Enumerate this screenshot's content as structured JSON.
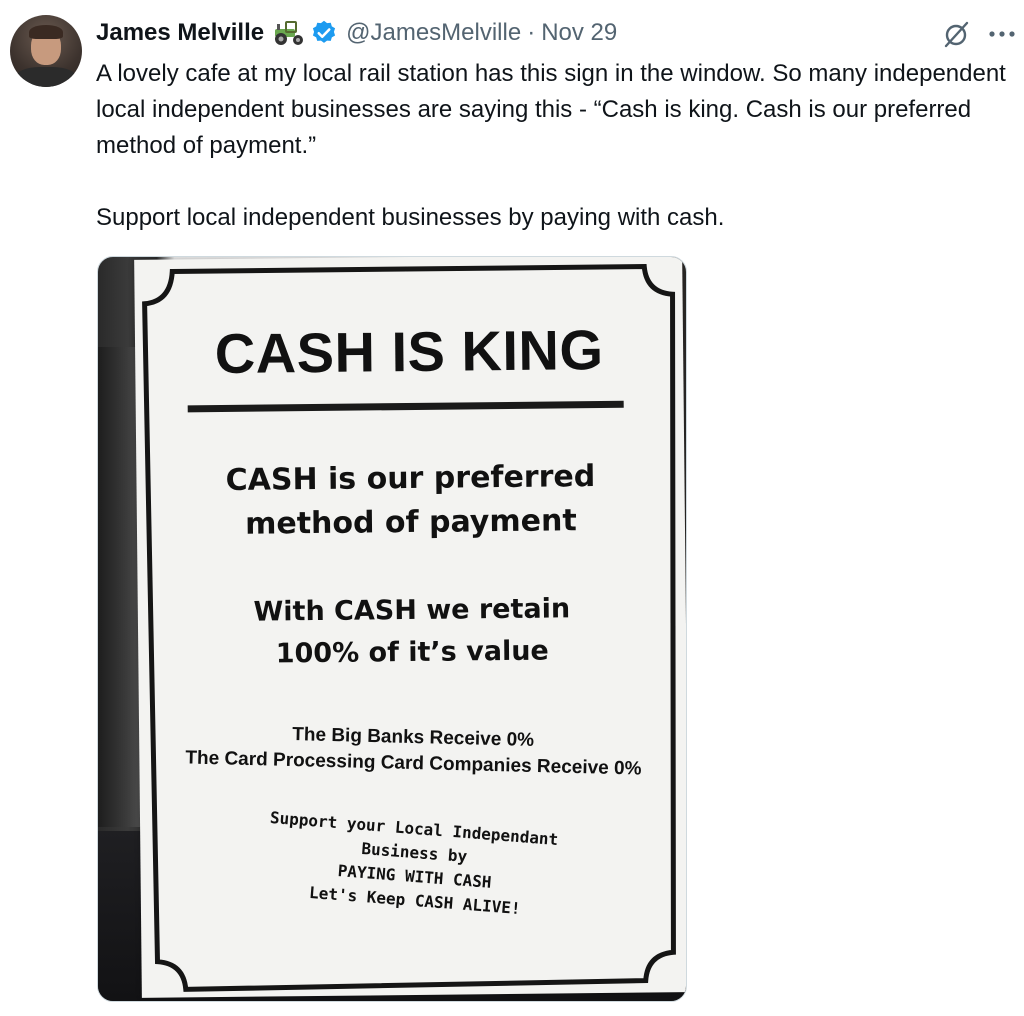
{
  "author": {
    "name": "James Melville",
    "handle": "@JamesMelville",
    "separator": "·",
    "date": "Nov 29",
    "badge_emoji_icon": "tractor-icon",
    "verified_icon": "verified-badge-icon",
    "verified_color": "#1d9bf0"
  },
  "actions": {
    "grok_icon": "grok-icon",
    "more_icon": "more-options-icon"
  },
  "tweet": {
    "paragraph1": "A lovely cafe at my local rail station has this sign in the window. So many independent local independent businesses are saying this - “Cash is king. Cash is our preferred method of payment.”",
    "paragraph2": "Support local independent businesses by paying with cash."
  },
  "sign": {
    "title": "CASH IS KING",
    "line1": "CASH is our preferred",
    "line2": "method of payment",
    "line3": "With CASH we retain",
    "line4": "100% of it’s value",
    "small1": "The Big Banks Receive 0%",
    "small2": "The Card Processing Card Companies Receive 0%",
    "closing1": "Support  your Local Independant",
    "closing2": "Business by",
    "closing3": "PAYING WITH CASH",
    "closing4": "Let's Keep CASH ALIVE!"
  },
  "colors": {
    "text_primary": "#0f1419",
    "text_secondary": "#536471",
    "border": "#cfd9de"
  }
}
